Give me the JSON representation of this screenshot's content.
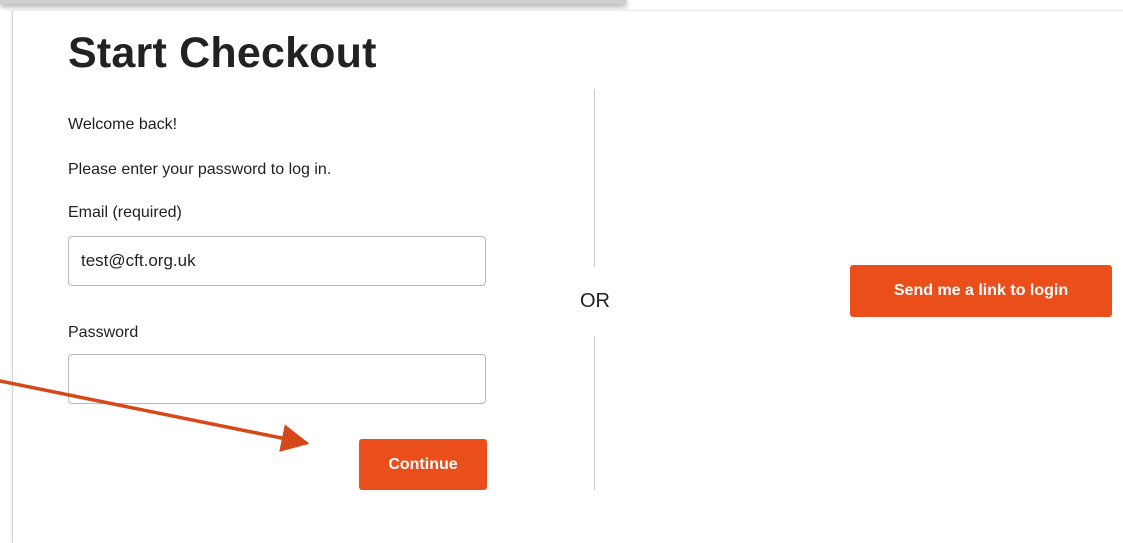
{
  "page": {
    "title": "Start Checkout"
  },
  "login": {
    "welcome_text": "Welcome back!",
    "instruction_text": "Please enter your password to log in.",
    "email_label": "Email (required)",
    "email_value": "test@cft.org.uk",
    "password_label": "Password",
    "password_value": "",
    "continue_label": "Continue"
  },
  "divider": {
    "or_label": "OR"
  },
  "magic_link": {
    "button_label": "Send me a link to login"
  },
  "colors": {
    "accent": "#e94e1b",
    "annotation_arrow": "#d6471a"
  }
}
